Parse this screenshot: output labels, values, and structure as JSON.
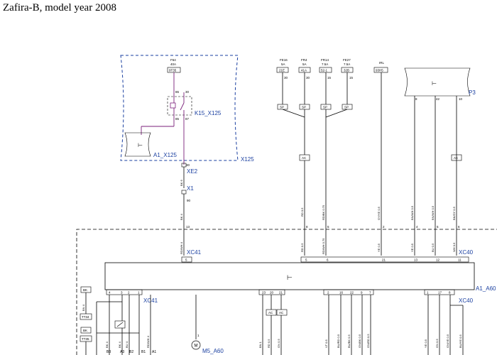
{
  "title": "Zafira-B, model year 2008",
  "colors": {
    "wire": "#000000",
    "relay_wire": "#7a1f7a",
    "label_blue": "#1a3fa0"
  },
  "fuses": [
    {
      "id": "F64",
      "rating": "40A",
      "socket": "9T35"
    },
    {
      "id": "FE16",
      "rating": "5A",
      "socket": "21E"
    },
    {
      "id": "FR4",
      "rating": "5A",
      "socket": "41A"
    },
    {
      "id": "FR14",
      "rating": "7.5A",
      "socket": "52-1"
    },
    {
      "id": "FE27",
      "rating": "7.5A",
      "socket": "32B"
    },
    {
      "id": "IRL",
      "rating": "",
      "socket": "93H5"
    }
  ],
  "fuse_pins": [
    "30",
    "30",
    "15",
    "15"
  ],
  "connectors": {
    "x125": "X125",
    "a1_x125": "A1_X125",
    "k15": "K15_X125",
    "xe2": "XE2",
    "x1": "X1",
    "p3": "P3",
    "xc41": "XC41",
    "xc40": "XC40",
    "a1": "A1_A60",
    "xc41b": "XC41",
    "xc40b": "XC40",
    "m5": "M5_A60"
  },
  "relay_pins": {
    "p86": "86",
    "p30": "30",
    "p85": "85",
    "p87": "87",
    "xe2_pin": "30",
    "x1_pin": "90",
    "motor_pin": "1"
  },
  "p3_pins": [
    "8",
    "42",
    "10"
  ],
  "splice_label": "SP",
  "ac_label": "AC",
  "wires_top": [
    "BK 6",
    "BK 4",
    "RD 0.5",
    "RD/BK 0.75",
    "GY/YE 0.5",
    "BN/WH 0.5",
    "BN/WH 0.5",
    "BK/GY 0.5"
  ],
  "pins_xc_top": [
    "13",
    "8",
    "5",
    "2",
    "4",
    "5",
    "6"
  ],
  "wires_mid": [
    "RD/WH 4",
    "RD 0.5",
    "RD/WH 0.75",
    "YE 0.5",
    "YE 0.5",
    "BU 0.5",
    "WH 0.5"
  ],
  "pins_a1_top": [
    "5",
    "5",
    "6",
    "21",
    "13",
    "12",
    "11"
  ],
  "pins_a1_bottom": [
    "4",
    "3",
    "2",
    "1",
    "23",
    "20",
    "21",
    "2",
    "16",
    "22",
    "9",
    "7",
    "1",
    "17",
    "8"
  ],
  "left_labels": [
    "BN 4",
    "BK 4",
    "BK 4",
    "BU 4",
    "RD/WH 4"
  ],
  "left_boxes": [
    "BK",
    "TT34",
    "BK",
    "TT35"
  ],
  "bottom_pins": [
    "B3",
    "A3",
    "B2",
    "B1",
    "A1"
  ],
  "wires_bottom": [
    "BN 1",
    "RD 0.5",
    "GN 0.5",
    "VT 0.5",
    "BU/RD 0.5",
    "BU/BK 0.5",
    "GN/BK 0.5",
    "GN/RD 0.5",
    "YE 0.5",
    "GN 0.5",
    "GN/YE 0.5",
    "BU/YE 0.5"
  ]
}
